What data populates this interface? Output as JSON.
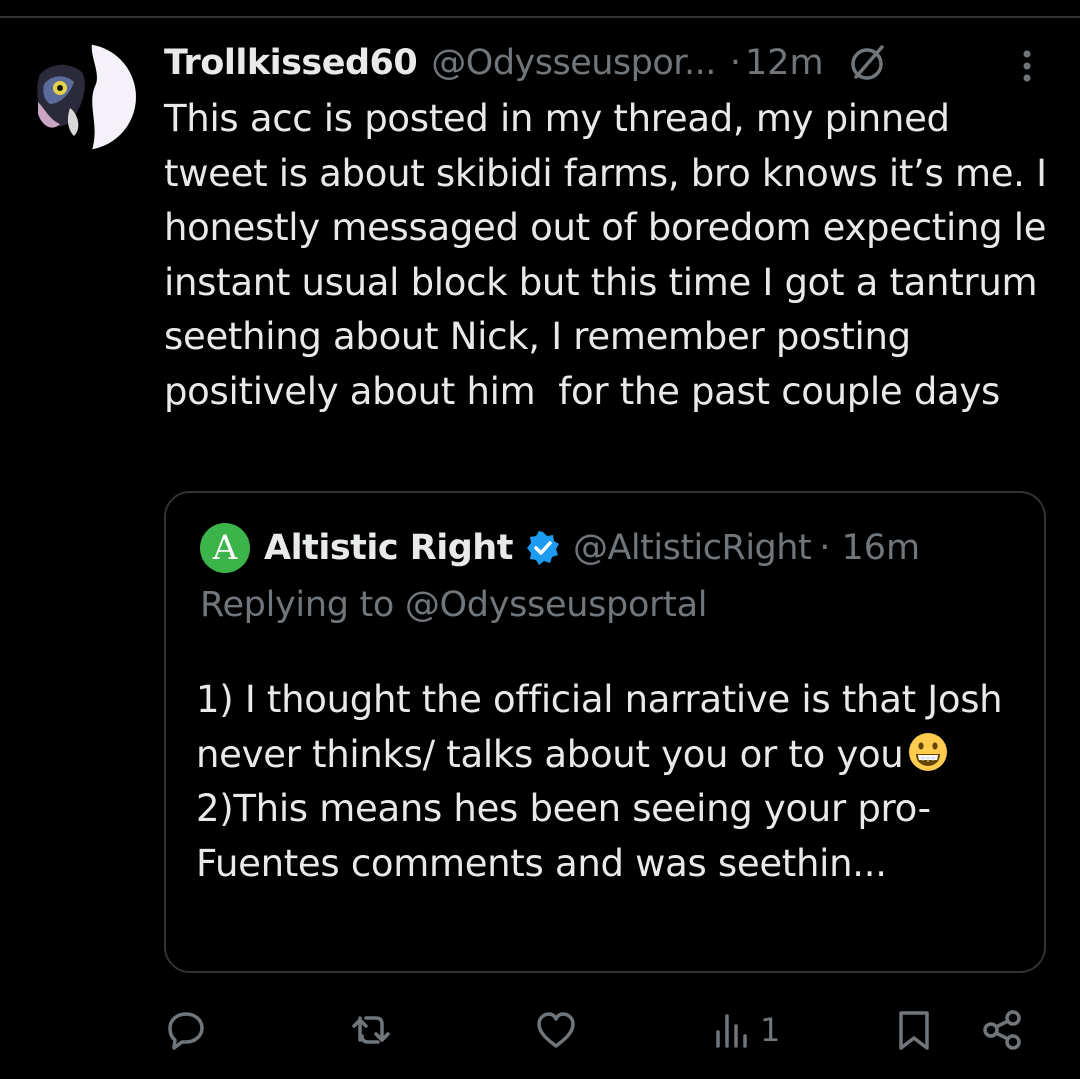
{
  "tweet": {
    "display_name": "Trollkissed60",
    "handle": "@Odysseuspor...",
    "time_separator": "·",
    "time": "12m",
    "text": "This acc is posted in my thread, my pinned tweet is about skibidi farms, bro knows it’s me. I honestly messaged out of boredom expecting le instant usual block but this time I got a tantrum seething about Nick, I remember posting positively about him  for the past couple days",
    "icons": [
      "avatar",
      "grok-icon",
      "more-vertical-icon"
    ]
  },
  "quote": {
    "avatar_letter": "A",
    "display_name": "Altistic Right",
    "verified": true,
    "handle": "@AltisticRight",
    "time": "· 16m",
    "replying_to": "Replying to @Odysseusportal",
    "text_part1": "1) I thought the official narrative is that Josh never thinks/ talks about you or to you",
    "emoji": "grinning-face-emoji",
    "text_part2": "2)This means hes been seeing your pro-Fuentes comments and was seethin...",
    "colors": {
      "avatar_bg": "#3bb54a",
      "verified": "#1d9bf0"
    }
  },
  "actions": {
    "views_count": "1",
    "icons": [
      "reply-icon",
      "retweet-icon",
      "like-icon",
      "views-icon",
      "bookmark-icon",
      "share-icon"
    ]
  },
  "colors": {
    "background": "#000000",
    "primary_text": "#e7e9ea",
    "secondary_text": "#71767b",
    "border": "#2f3336"
  }
}
